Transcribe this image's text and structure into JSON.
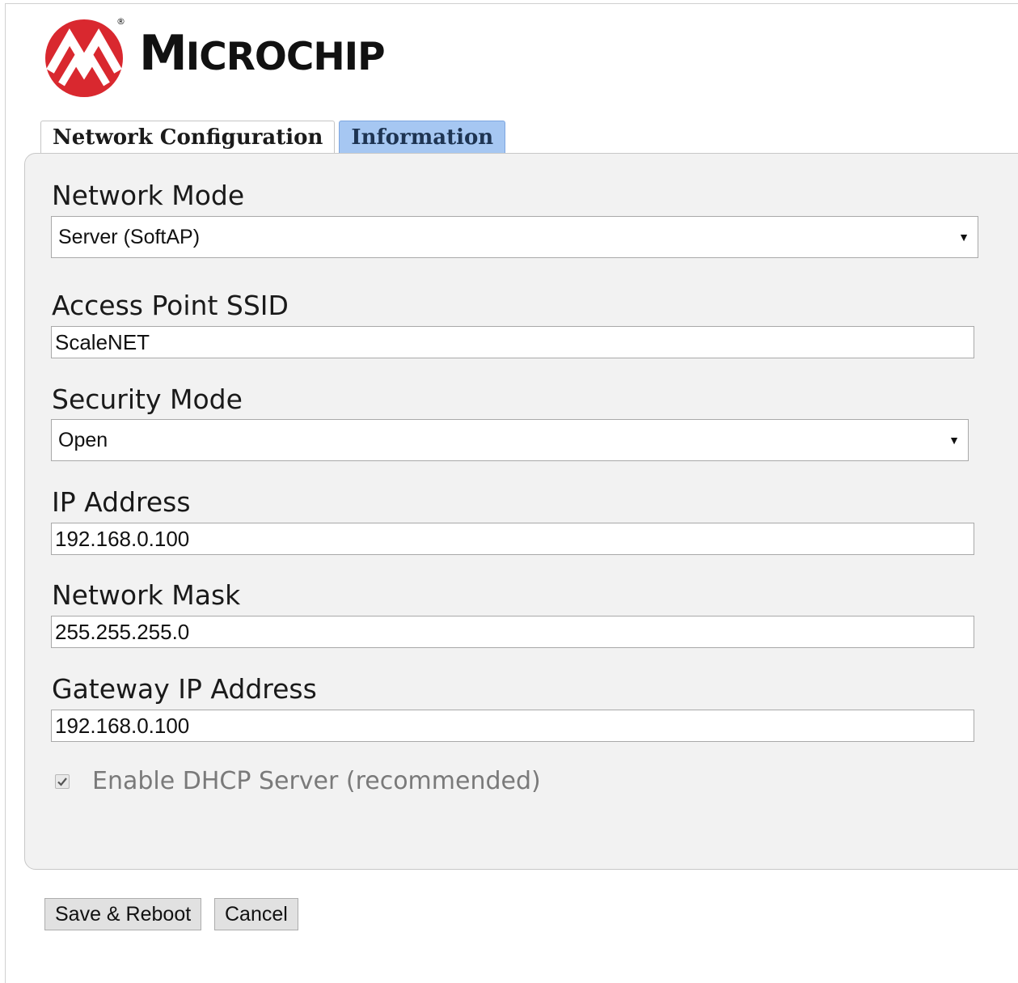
{
  "logo": {
    "wordmark_first": "M",
    "wordmark_rest": "ICROCHIP",
    "registered": "®",
    "brand_color": "#d9282f"
  },
  "tabs": [
    {
      "label": "Network Configuration",
      "state": "selected"
    },
    {
      "label": "Information",
      "state": "unselected"
    }
  ],
  "form": {
    "network_mode": {
      "label": "Network Mode",
      "value": "Server (SoftAP)"
    },
    "ssid": {
      "label": "Access Point SSID",
      "value": "ScaleNET"
    },
    "security_mode": {
      "label": "Security Mode",
      "value": "Open"
    },
    "ip_address": {
      "label": "IP Address",
      "value": "192.168.0.100"
    },
    "network_mask": {
      "label": "Network Mask",
      "value": "255.255.255.0"
    },
    "gateway": {
      "label": "Gateway IP Address",
      "value": "192.168.0.100"
    },
    "dhcp": {
      "label": "Enable DHCP Server (recommended)",
      "checked": true,
      "disabled": true
    }
  },
  "buttons": {
    "save": "Save & Reboot",
    "cancel": "Cancel"
  },
  "icons": {
    "dropdown": "chevron-down-icon",
    "check": "check-icon"
  }
}
